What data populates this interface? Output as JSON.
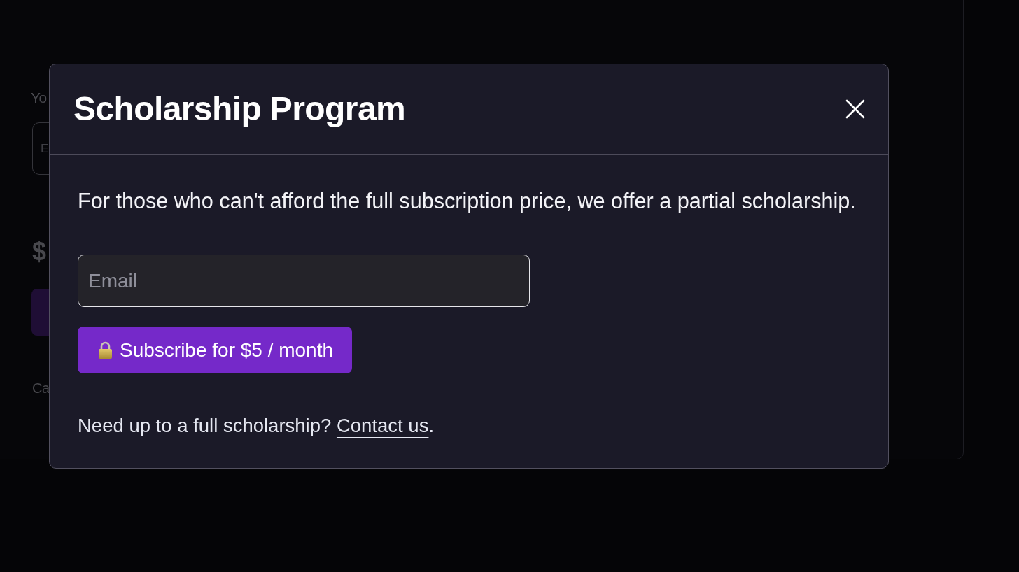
{
  "background_page": {
    "label": "Yo",
    "field": {
      "placeholder": "E"
    },
    "price": "$",
    "caption": "Ca"
  },
  "dialog": {
    "title": "Scholarship Program",
    "description": "For those who can't afford the full subscription price, we offer a partial scholarship.",
    "email_field": {
      "placeholder": "Email"
    },
    "subscribe_button": {
      "label": "Subscribe for $5 / month"
    },
    "footer": {
      "text": "Need up to a full scholarship?",
      "link": "Contact us",
      "end": "."
    }
  }
}
